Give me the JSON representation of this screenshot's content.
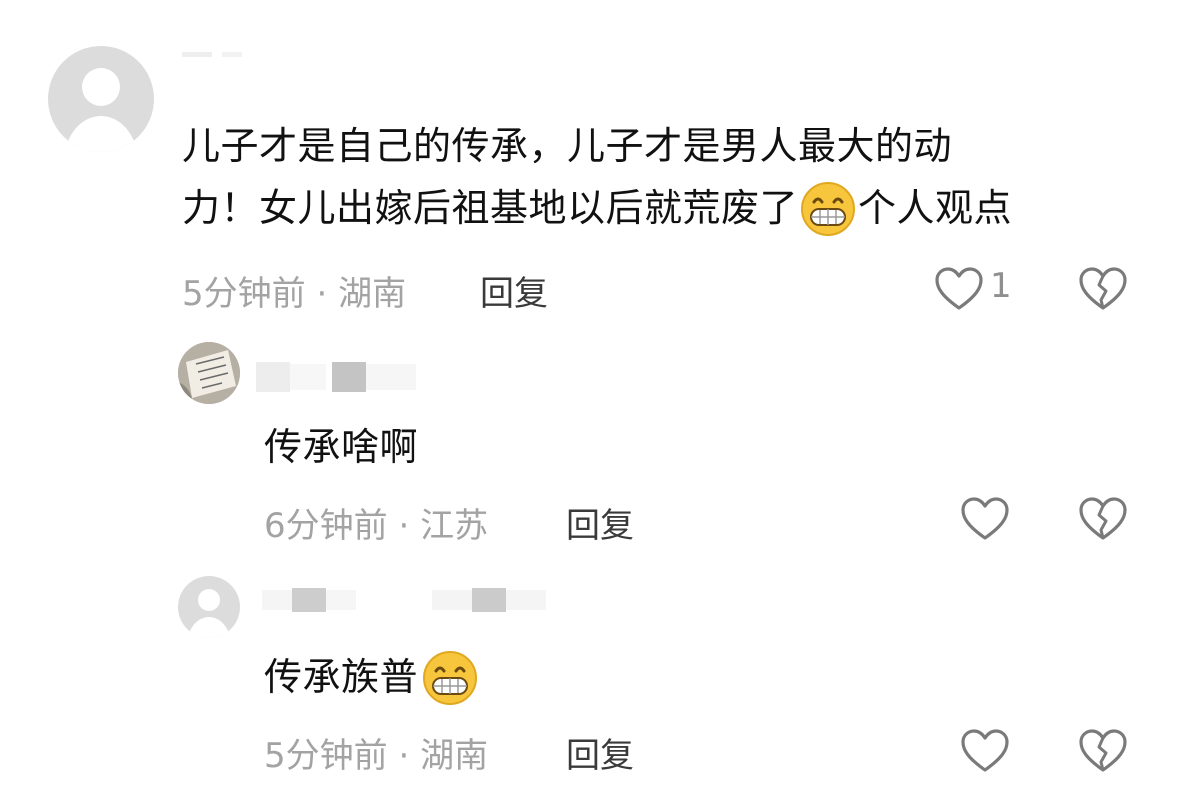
{
  "comment": {
    "text_line1": "儿子才是自己的传承，儿子才是男人最大的动",
    "text_line2_before_emoji": "力！女儿出嫁后祖基地以后就荒废了",
    "text_line2_after_emoji": "个人观点",
    "emoji": "grinning-teeth-emoji",
    "time": "5分钟前",
    "location": "湖南",
    "reply_label": "回复",
    "like_count": "1"
  },
  "replies": [
    {
      "text": "传承啥啊",
      "time": "6分钟前",
      "location": "江苏",
      "reply_label": "回复"
    },
    {
      "text": "传承族普",
      "emoji": "grinning-teeth-emoji",
      "time": "5分钟前",
      "location": "湖南",
      "reply_label": "回复"
    }
  ],
  "separator": " · ",
  "icons": {
    "like": "heart-outline-icon",
    "dislike": "broken-heart-icon"
  },
  "colors": {
    "text": "#111111",
    "meta": "#a3a3a3",
    "icon": "#7a7a7a",
    "avatar_bg": "#dcdcdc"
  }
}
